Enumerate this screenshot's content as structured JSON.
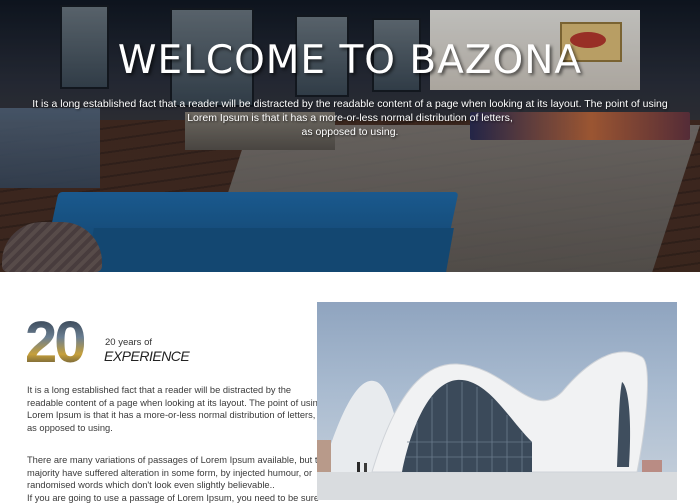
{
  "hero": {
    "title": "WELCOME TO BAZONA",
    "text_lines": [
      "It is a long established fact that a reader will be distracted by the readable content of a page when looking at its layout. The point of using",
      "Lorem Ipsum is that it has a more-or-less normal distribution of letters,",
      "as opposed to using."
    ]
  },
  "about": {
    "years_number": "20",
    "years_label": "20 years of",
    "experience_label": "EXPERIENCE",
    "paragraph1_lines": [
      "It is a long established fact that a reader will be distracted by the",
      "readable content of a page when looking at its layout. The point of using",
      "Lorem Ipsum is that it has a more-or-less normal distribution of letters,",
      "as opposed to using."
    ],
    "paragraph2_lines": [
      "There are many variations of passages of Lorem Ipsum available, but the",
      "majority have suffered alteration in some form, by injected humour, or",
      "randomised words which don't look even slightly believable..",
      "If you are going to use a passage of Lorem Ipsum, you need to be sure"
    ]
  },
  "colors": {
    "hero_text": "#ffffff",
    "lounger_blue": "#1f6fb0",
    "body_text": "#3a3a3a",
    "sky": "#a9bbd0"
  }
}
